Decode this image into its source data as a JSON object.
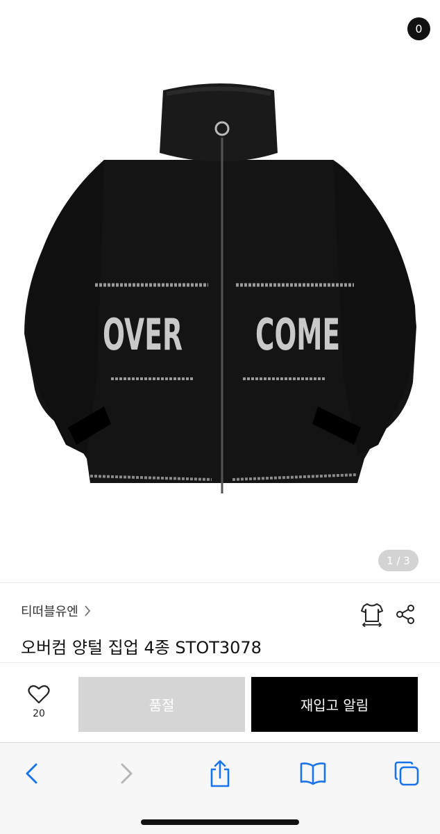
{
  "colors": {
    "accent_blue": "#1a73e8",
    "soldout_bg": "#d5d5d5",
    "restock_bg": "#000000",
    "badge_bg": "#111111"
  },
  "topnav": {
    "icons": [
      "back-arrow-icon",
      "home-icon",
      "search-icon",
      "cart-icon"
    ],
    "cart_count": "0"
  },
  "gallery": {
    "jacket_print_left": "OVER",
    "jacket_print_right": "COME",
    "page_indicator": "1 / 3"
  },
  "product": {
    "brand": "티떠블유엔",
    "title": "오버컴 양털 집업 4종 STOT3078"
  },
  "actions": {
    "like_count": "20",
    "soldout_label": "품절",
    "restock_label": "재입고 알림"
  },
  "browser_toolbar": {
    "icons": [
      "back-icon",
      "forward-icon",
      "share-icon",
      "bookmarks-icon",
      "tabs-icon"
    ]
  }
}
